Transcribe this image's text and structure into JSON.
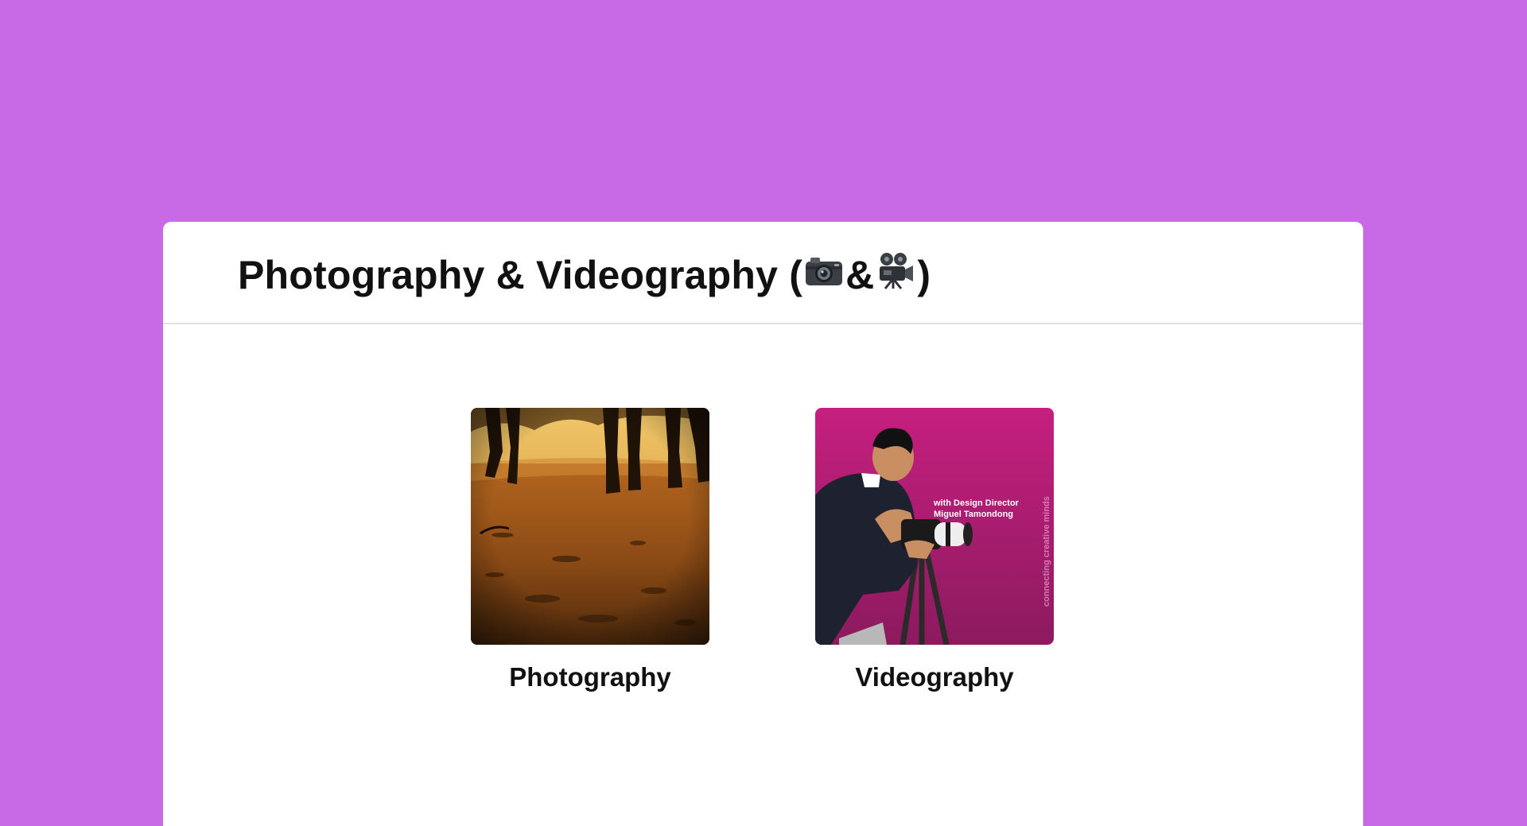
{
  "page": {
    "title_text": "Photography & Videography (",
    "title_amp": " & ",
    "title_close": ")",
    "title_icons": [
      "camera-icon",
      "movie-camera-icon"
    ]
  },
  "tiles": [
    {
      "label": "Photography",
      "image": "feet-walking-on-dirt-path-photo"
    },
    {
      "label": "Videography",
      "image": "man-with-camera-on-tripod-photo",
      "overlay_line1": "with Design Director",
      "overlay_line2": "Miguel Tamondong",
      "side_text": "connecting creative minds"
    }
  ],
  "colors": {
    "background": "#c86ae6",
    "card": "#ffffff",
    "video_tile_bg": "#c0267f"
  }
}
